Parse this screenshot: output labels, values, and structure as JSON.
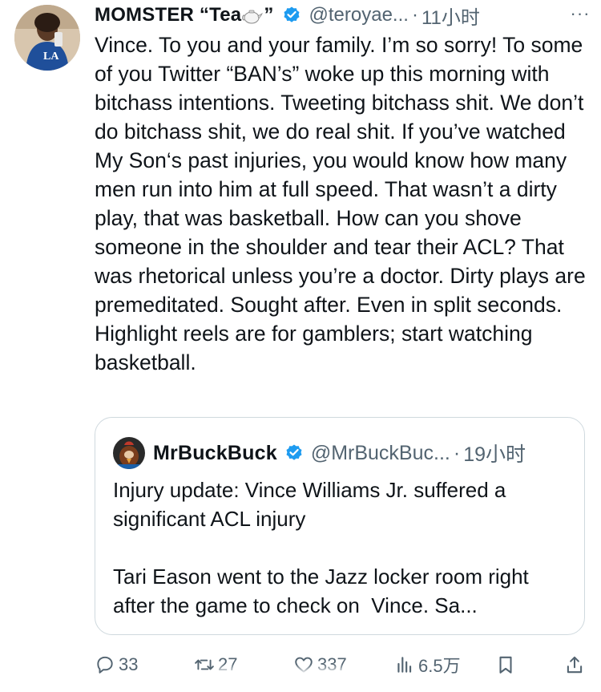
{
  "author": {
    "name": "MOMSTER “Tea",
    "name_suffix": "”",
    "handle": "@teroyae...",
    "separator": "·",
    "time": "11小时",
    "more_label": "···"
  },
  "tweet": {
    "text": "Vince. To you and your family. I’m so sorry! To some of you Twitter “BAN’s” woke up this morning with bitchass intentions. Tweeting bitchass shit. We don’t do bitchass shit, we do real shit. If you’ve watched My Son‘s past injuries, you would know how many men run into him at full speed. That wasn’t a dirty play, that was basketball. How can you shove someone in the shoulder and tear their ACL? That was rhetorical unless you’re a doctor. Dirty plays are premeditated. Sought after. Even in split seconds. Highlight reels are for gamblers; start watching basketball."
  },
  "quoted": {
    "name": "MrBuckBuck",
    "handle": "@MrBuckBuc...",
    "separator": "·",
    "time": "19小时",
    "text": "Injury update: Vince Williams Jr. suffered a significant ACL injury\n\nTari Eason went to the Jazz locker room right after the game to check on  Vince. Sa..."
  },
  "actions": {
    "replies": "33",
    "retweets": "27",
    "likes": "337",
    "views": "6.5万"
  },
  "icons": {
    "verified": "verified-badge-icon",
    "teapot": "teapot-emoji-icon",
    "reply": "reply-icon",
    "retweet": "retweet-icon",
    "like": "heart-icon",
    "views": "views-chart-icon",
    "bookmark": "bookmark-icon",
    "share": "share-icon"
  },
  "colors": {
    "verified": "#1d9bf0",
    "muted": "#536471",
    "text": "#0f1419",
    "border": "#cfd9de"
  }
}
